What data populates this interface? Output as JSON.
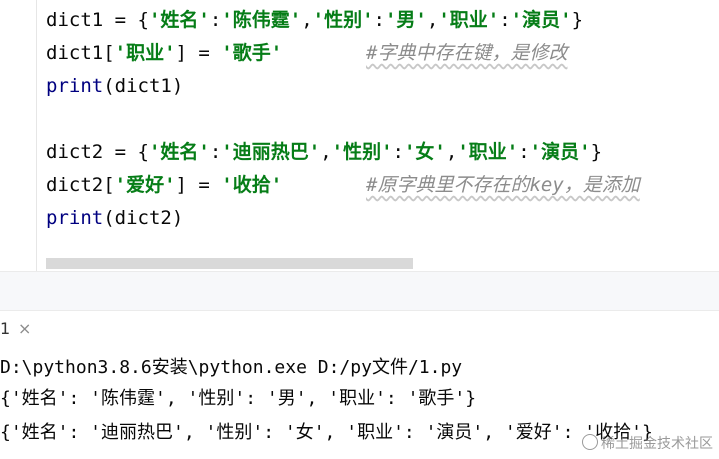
{
  "editor": {
    "line1": {
      "a": "dict1 = {",
      "b": "'姓名'",
      "c": ":",
      "d": "'陈伟霆'",
      "e": ",",
      "f": "'性别'",
      "g": ":",
      "h": "'男'",
      "i": ",",
      "j": "'职业'",
      "k": ":",
      "l": "'演员'",
      "m": "}"
    },
    "line2": {
      "a": "dict1[",
      "b": "'职业'",
      "c": "] = ",
      "d": "'歌手'",
      "comment": "#字典中存在键，是修改"
    },
    "line3": {
      "fn": "print",
      "rest": "(dict1)"
    },
    "line5": {
      "a": "dict2 = {",
      "b": "'姓名'",
      "c": ":",
      "d": "'迪丽热巴'",
      "e": ",",
      "f": "'性别'",
      "g": ":",
      "h": "'女'",
      "i": ",",
      "j": "'职业'",
      "k": ":",
      "l": "'演员'",
      "m": "}"
    },
    "line6": {
      "a": "dict2[",
      "b": "'爱好'",
      "c": "] = ",
      "d": "'收拾'",
      "comment": "#原字典里不存在的key，是添加"
    },
    "line7": {
      "fn": "print",
      "rest": "(dict2)"
    }
  },
  "run_tab": {
    "label": "1",
    "close": "×"
  },
  "console": {
    "line1": "D:\\python3.8.6安装\\python.exe D:/py文件/1.py",
    "line2": "{'姓名': '陈伟霆', '性别': '男', '职业': '歌手'}",
    "line3": "{'姓名': '迪丽热巴', '性别': '女', '职业': '演员', '爱好': '收拾'}"
  },
  "watermark": "稀土掘金技术社区"
}
